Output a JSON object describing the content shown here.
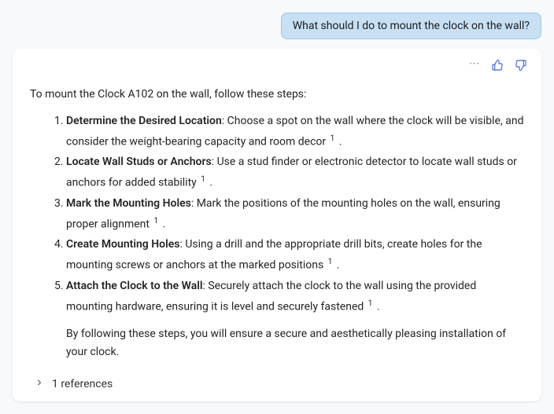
{
  "user_message": "What should I do to mount the clock on the wall?",
  "assistant": {
    "intro": "To mount the Clock A102 on the wall, follow these steps:",
    "steps": [
      {
        "title": "Determine the Desired Location",
        "body": ": Choose a spot on the wall where the clock will be visible, and consider the weight-bearing capacity and room decor ",
        "cite": "1",
        "tail": " ."
      },
      {
        "title": "Locate Wall Studs or Anchors",
        "body": ": Use a stud finder or electronic detector to locate wall studs or anchors for added stability ",
        "cite": "1",
        "tail": " ."
      },
      {
        "title": "Mark the Mounting Holes",
        "body": ": Mark the positions of the mounting holes on the wall, ensuring proper alignment ",
        "cite": "1",
        "tail": " ."
      },
      {
        "title": "Create Mounting Holes",
        "body": ": Using a drill and the appropriate drill bits, create holes for the mounting screws or anchors at the marked positions ",
        "cite": "1",
        "tail": " ."
      },
      {
        "title": "Attach the Clock to the Wall",
        "body": ": Securely attach the clock to the wall using the provided mounting hardware, ensuring it is level and securely fastened ",
        "cite": "1",
        "tail": " ."
      }
    ],
    "closing": "By following these steps, you will ensure a secure and aesthetically pleasing installation of your clock."
  },
  "references": {
    "label": "1 references"
  },
  "icons": {
    "more": "···",
    "thumbs_up": "thumbs-up-icon",
    "thumbs_down": "thumbs-down-icon",
    "chevron": "›"
  }
}
